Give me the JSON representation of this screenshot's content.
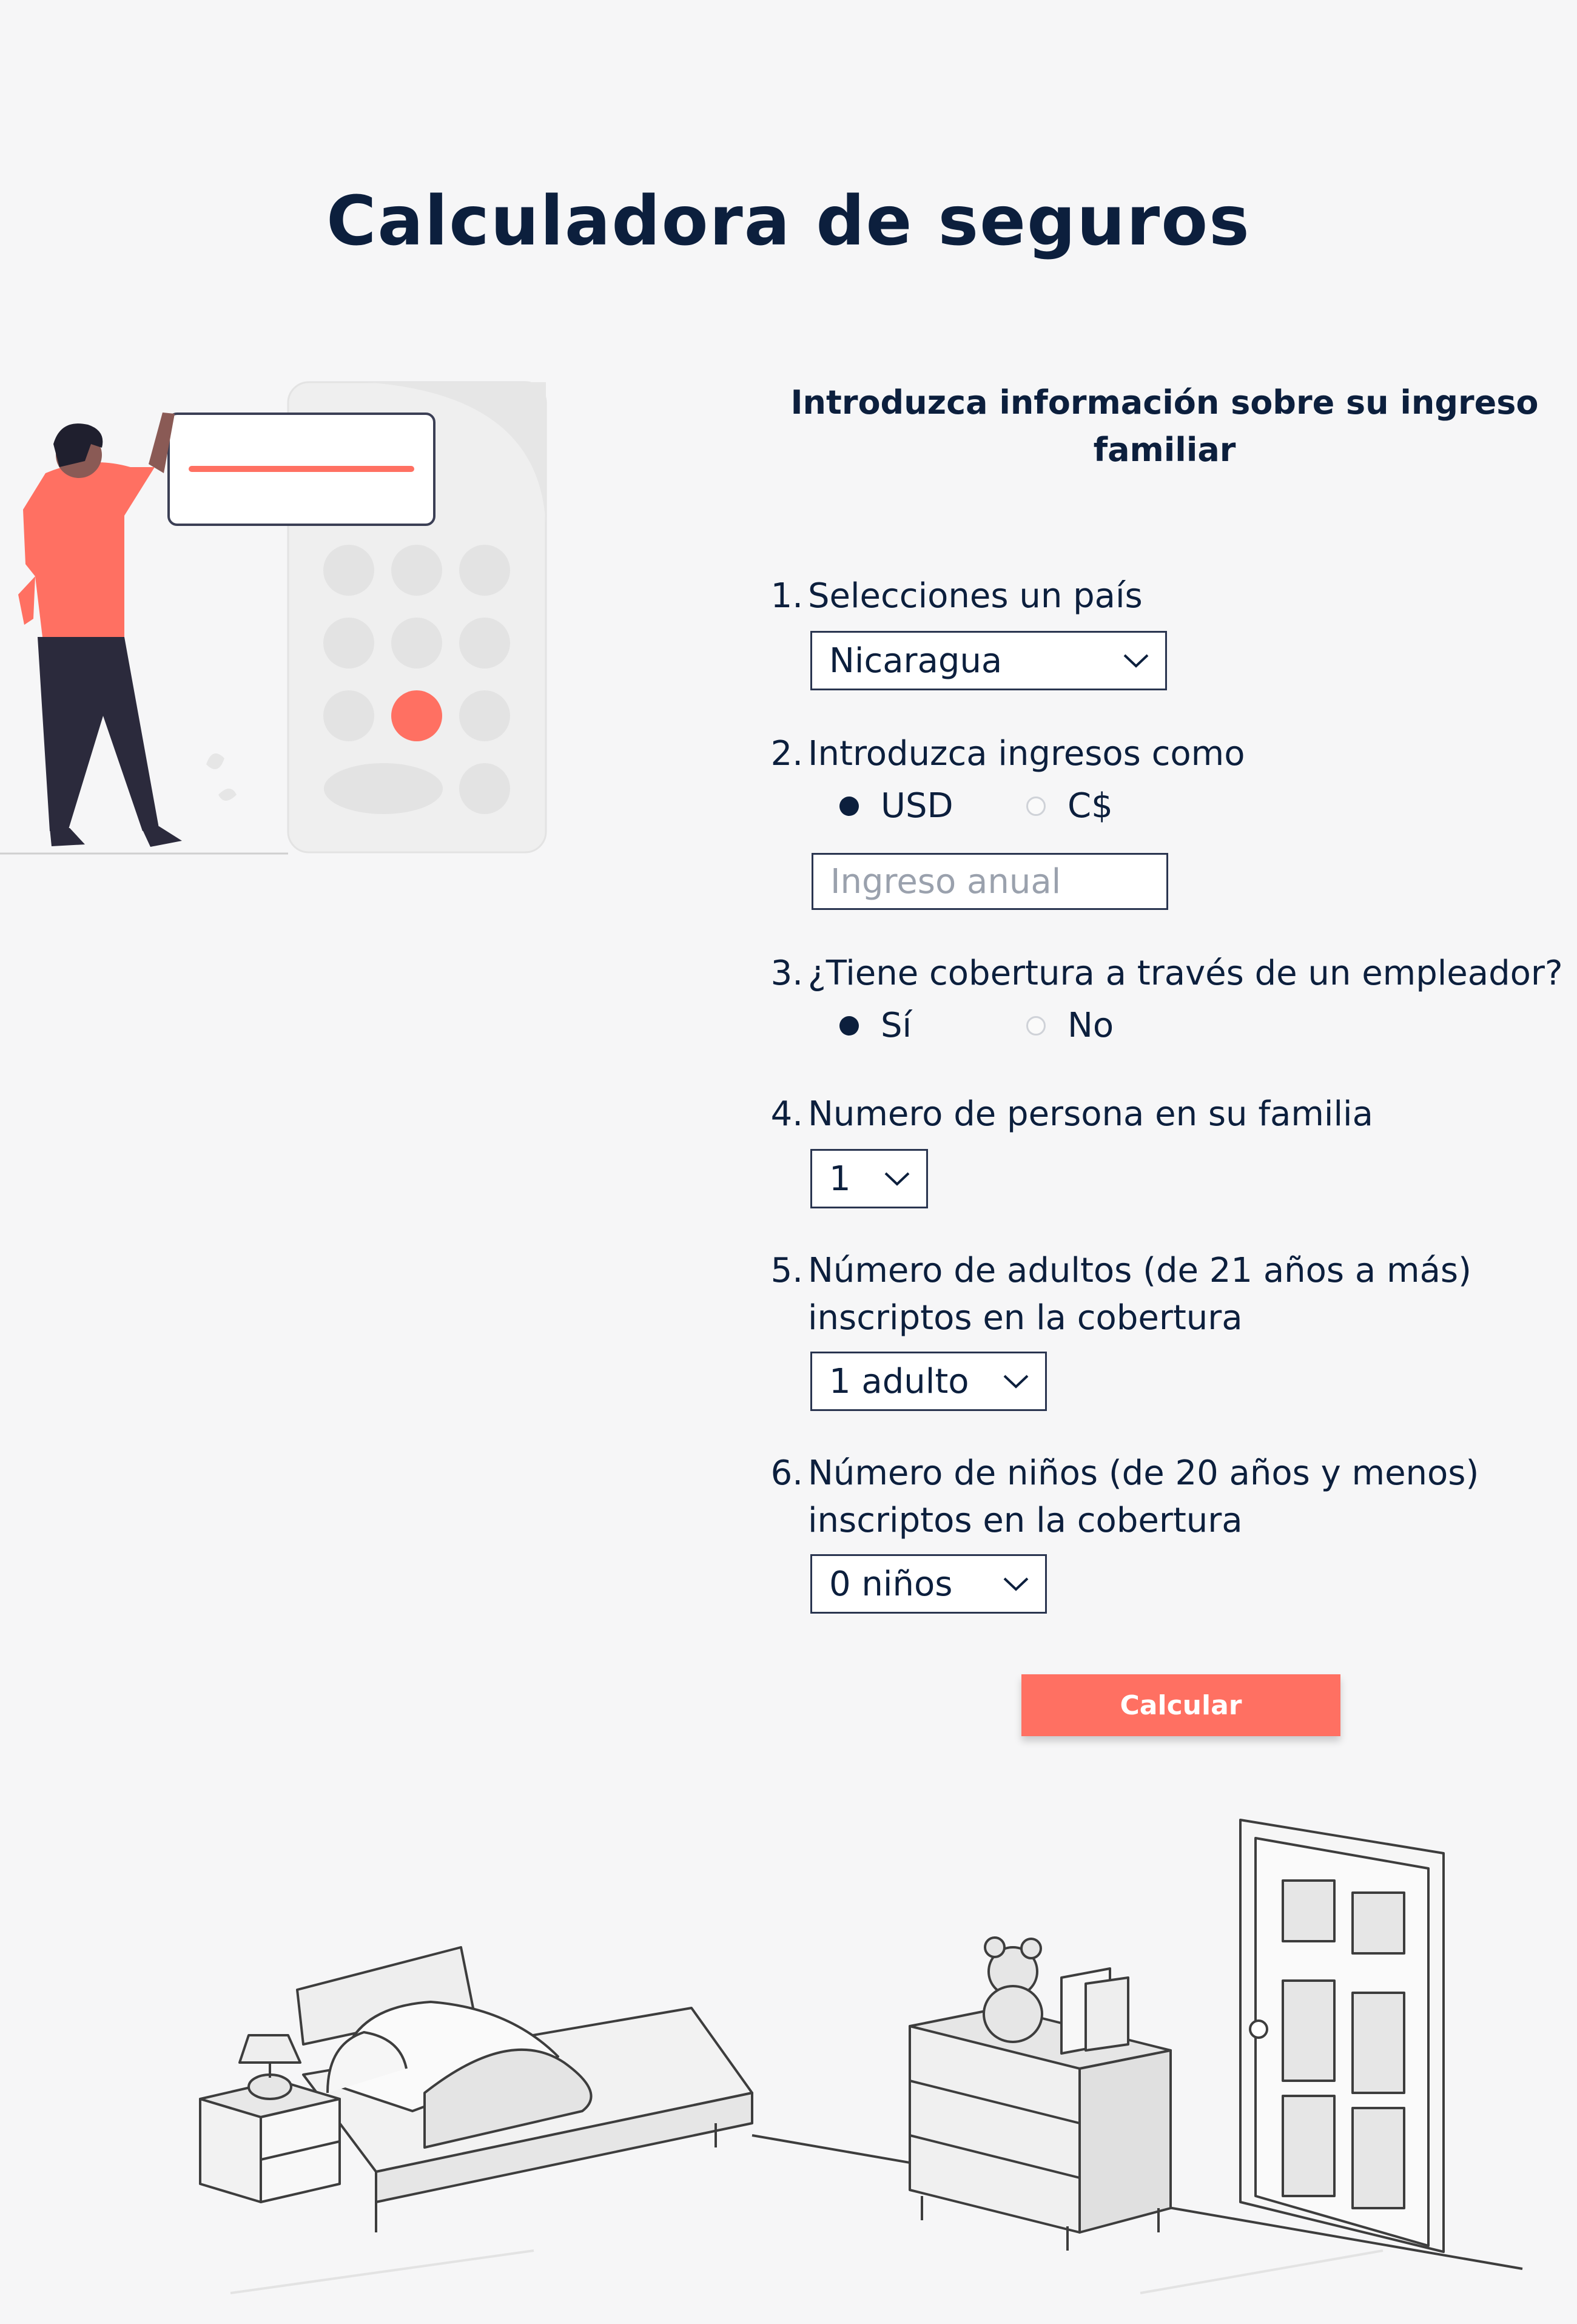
{
  "page": {
    "title": "Calculadora de seguros",
    "subtitle": "Introduzca información sobre su ingreso familiar"
  },
  "form": {
    "q1": {
      "number": "1.",
      "label": "Selecciones un país",
      "selected": "Nicaragua"
    },
    "q2": {
      "number": "2.",
      "label": "Introduzca ingresos como",
      "options": [
        {
          "label": "USD",
          "checked": true
        },
        {
          "label": "C$",
          "checked": false
        }
      ],
      "input_placeholder": "Ingreso anual"
    },
    "q3": {
      "number": "3.",
      "label": "¿Tiene cobertura a través de un empleador?",
      "options": [
        {
          "label": "Sí",
          "checked": true
        },
        {
          "label": "No",
          "checked": false
        }
      ]
    },
    "q4": {
      "number": "4.",
      "label": "Numero de persona en su familia",
      "selected": "1"
    },
    "q5": {
      "number": "5.",
      "label_line1": "Número de adultos (de 21 años a más)",
      "label_line2": "inscriptos en la cobertura",
      "selected": "1 adulto"
    },
    "q6": {
      "number": "6.",
      "label_line1": "Número de niños (de 20 años y menos)",
      "label_line2": "inscriptos en la cobertura",
      "selected": "0 niños"
    },
    "submit_label": "Calcular"
  },
  "colors": {
    "navy": "#0c1f3d",
    "accent": "#ff7062",
    "background": "#f6f6f7"
  },
  "illustrations": [
    "person-calculator-illustration",
    "bedroom-illustration"
  ]
}
